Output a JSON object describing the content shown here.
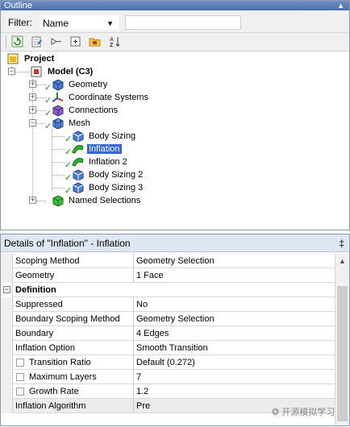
{
  "outline": {
    "title": "Outline",
    "filter_label": "Filter:",
    "filter_value": "Name",
    "tree": {
      "project": "Project",
      "model": "Model (C3)",
      "geometry": "Geometry",
      "coordinate_systems": "Coordinate Systems",
      "connections": "Connections",
      "mesh": "Mesh",
      "body_sizing": "Body Sizing",
      "inflation": "Inflation",
      "inflation_2": "Inflation 2",
      "body_sizing_2": "Body Sizing 2",
      "body_sizing_3": "Body Sizing 3",
      "named_selections": "Named Selections"
    }
  },
  "details": {
    "title": "Details of \"Inflation\" - Inflation",
    "rows": [
      {
        "name": "Scoping Method",
        "value": "Geometry Selection"
      },
      {
        "name": "Geometry",
        "value": "1 Face"
      },
      {
        "name": "Definition",
        "value": ""
      },
      {
        "name": "Suppressed",
        "value": "No"
      },
      {
        "name": "Boundary Scoping Method",
        "value": "Geometry Selection"
      },
      {
        "name": "Boundary",
        "value": "4 Edges"
      },
      {
        "name": "Inflation Option",
        "value": "Smooth Transition"
      },
      {
        "name": "Transition Ratio",
        "value": "Default (0.272)"
      },
      {
        "name": "Maximum Layers",
        "value": "7"
      },
      {
        "name": "Growth Rate",
        "value": "1.2"
      },
      {
        "name": "Inflation Algorithm",
        "value": "Pre"
      }
    ],
    "watermark": "开源模拟学习"
  },
  "colors": {
    "selection": "#3367d6",
    "check": "#1e9a1e",
    "title_bar": "#4a6ea8"
  },
  "icons": [
    "refresh-icon",
    "document-icon",
    "filter-icon",
    "expand-all-icon",
    "folder-icon",
    "sort-icon"
  ]
}
